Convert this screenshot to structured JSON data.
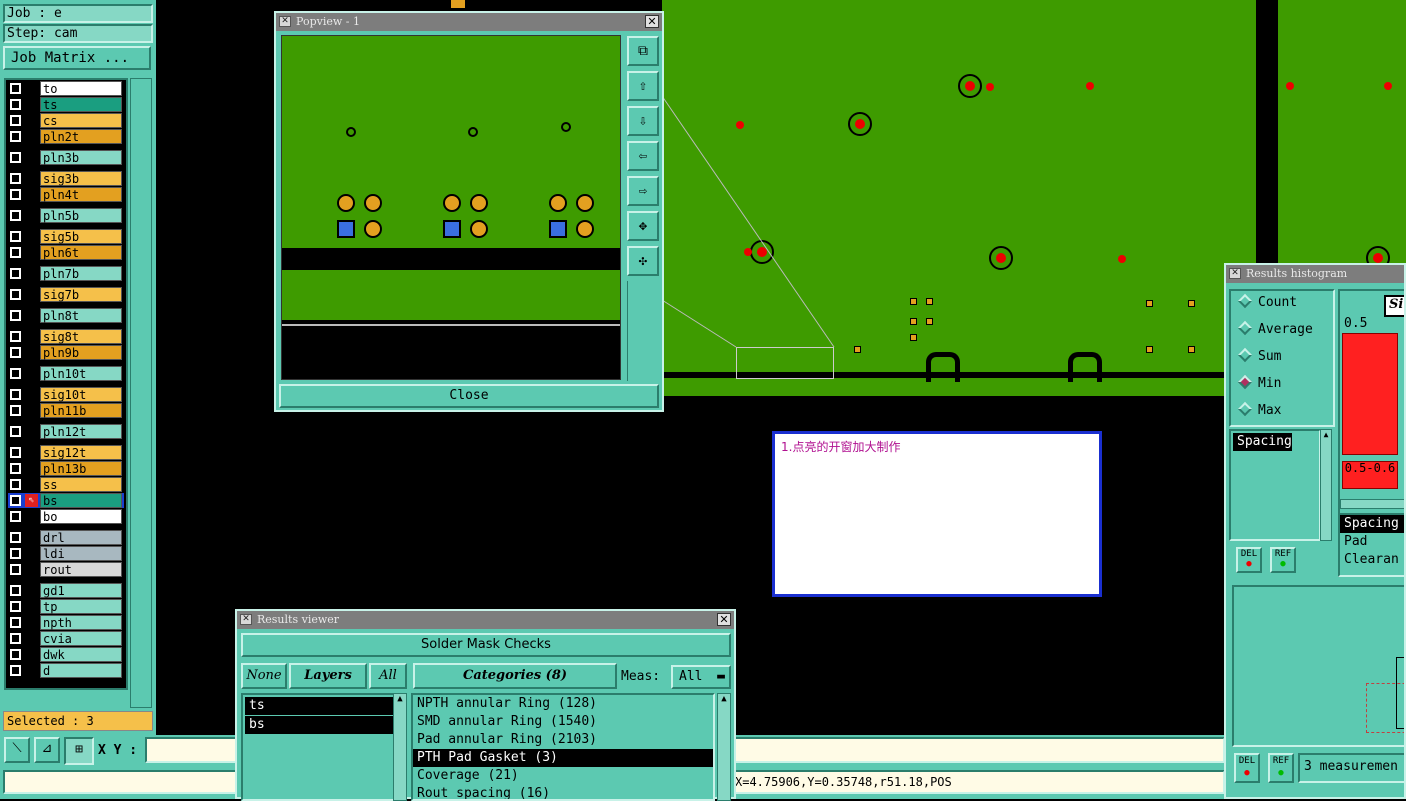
{
  "left_panel": {
    "job_label": "Job : e",
    "step_label": "Step: cam",
    "matrix_button": "Job Matrix ...",
    "selected_label": "Selected : 3",
    "layers": [
      {
        "name": "to",
        "color": "#ffffff"
      },
      {
        "name": "ts",
        "color": "#1a9e80"
      },
      {
        "name": "cs",
        "color": "#f5c04a"
      },
      {
        "name": "pln2t",
        "color": "#e3a020"
      },
      {
        "name": "pln3b",
        "color": "#86d8c5"
      },
      {
        "name": "sig3b",
        "color": "#f5c04a"
      },
      {
        "name": "pln4t",
        "color": "#e3a020"
      },
      {
        "name": "pln5b",
        "color": "#86d8c5"
      },
      {
        "name": "sig5b",
        "color": "#f5c04a"
      },
      {
        "name": "pln6t",
        "color": "#e3a020"
      },
      {
        "name": "pln7b",
        "color": "#86d8c5"
      },
      {
        "name": "sig7b",
        "color": "#f5c04a"
      },
      {
        "name": "pln8t",
        "color": "#86d8c5"
      },
      {
        "name": "sig8t",
        "color": "#f5c04a"
      },
      {
        "name": "pln9b",
        "color": "#e3a020"
      },
      {
        "name": "pln10t",
        "color": "#86d8c5"
      },
      {
        "name": "sig10t",
        "color": "#f5c04a"
      },
      {
        "name": "pln11b",
        "color": "#e3a020"
      },
      {
        "name": "pln12t",
        "color": "#86d8c5"
      },
      {
        "name": "sig12t",
        "color": "#f5c04a"
      },
      {
        "name": "pln13b",
        "color": "#e3a020"
      },
      {
        "name": "ss",
        "color": "#f5c04a"
      },
      {
        "name": "bs",
        "color": "#1a9e80"
      },
      {
        "name": "bo",
        "color": "#ffffff"
      },
      {
        "name": "drl",
        "color": "#a8b8c0"
      },
      {
        "name": "ldi",
        "color": "#a8b8c0"
      },
      {
        "name": "rout",
        "color": "#d8d8d8"
      },
      {
        "name": "gd1",
        "color": "#86d8c5"
      },
      {
        "name": "tp",
        "color": "#86d8c5"
      },
      {
        "name": "npth",
        "color": "#86d8c5"
      },
      {
        "name": "cvia",
        "color": "#86d8c5"
      },
      {
        "name": "dwk",
        "color": "#86d8c5"
      },
      {
        "name": "d",
        "color": "#86d8c5"
      }
    ]
  },
  "bottom_bar": {
    "xy_label": "X Y :",
    "coords": "X=4.75906,Y=0.35748,r51.18,POS"
  },
  "popview": {
    "title": "Popview - 1",
    "close_button": "Close"
  },
  "note": {
    "text": "1.点亮的开窗加大制作"
  },
  "results_viewer": {
    "title": "Results viewer",
    "header": "Solder Mask Checks",
    "none_button": "None",
    "layers_button": "Layers",
    "all_button": "All",
    "categories_button": "Categories (8)",
    "meas_label": "Meas:",
    "meas_value": "All",
    "layers": [
      "ts",
      "bs"
    ],
    "categories": [
      "NPTH annular Ring (128)",
      "SMD annular Ring (1540)",
      "Pad annular Ring (2103)",
      "PTH Pad Gasket (3)",
      "Coverage (21)",
      "Rout spacing (16)"
    ],
    "selected_category": 3
  },
  "histogram": {
    "title": "Results histogram",
    "options": [
      "Count",
      "Average",
      "Sum",
      "Min",
      "Max"
    ],
    "selected_option": "Min",
    "list_item": "Spacing",
    "del_label": "DEL",
    "ref_label": "REF",
    "bar_top_label": "0.5",
    "bar_range_label": "0.5-0.6",
    "header_partial": "Si",
    "legend": [
      "Spacing",
      "Pad",
      "Clearan"
    ],
    "status": "3 measuremen"
  }
}
